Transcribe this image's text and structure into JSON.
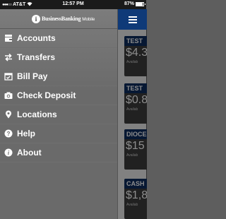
{
  "status_bar": {
    "carrier": "AT&T",
    "time": "12:57 PM",
    "battery": "87%",
    "battery_level": 0.87
  },
  "logo": {
    "letter": "i",
    "name": "BusinessBanking",
    "suffix": "Mobile"
  },
  "menu": {
    "items": [
      {
        "label": "Accounts",
        "icon": "wallet-icon"
      },
      {
        "label": "Transfers",
        "icon": "transfer-arrows-icon"
      },
      {
        "label": "Bill Pay",
        "icon": "calendar-icon"
      },
      {
        "label": "Check Deposit",
        "icon": "camera-icon"
      },
      {
        "label": "Locations",
        "icon": "map-pin-icon"
      },
      {
        "label": "Help",
        "icon": "help-icon"
      },
      {
        "label": "About",
        "icon": "info-icon"
      }
    ]
  },
  "accounts_peek": [
    {
      "name": "TEST",
      "balance": "$4.3",
      "note": "Availab"
    },
    {
      "name": "TEST",
      "balance": "$0.8",
      "note": "Availab"
    },
    {
      "name": "DIOCE",
      "balance": "$15",
      "note": "Availab"
    },
    {
      "name": "CASH",
      "balance": "$1,8",
      "note": "Availab"
    }
  ]
}
